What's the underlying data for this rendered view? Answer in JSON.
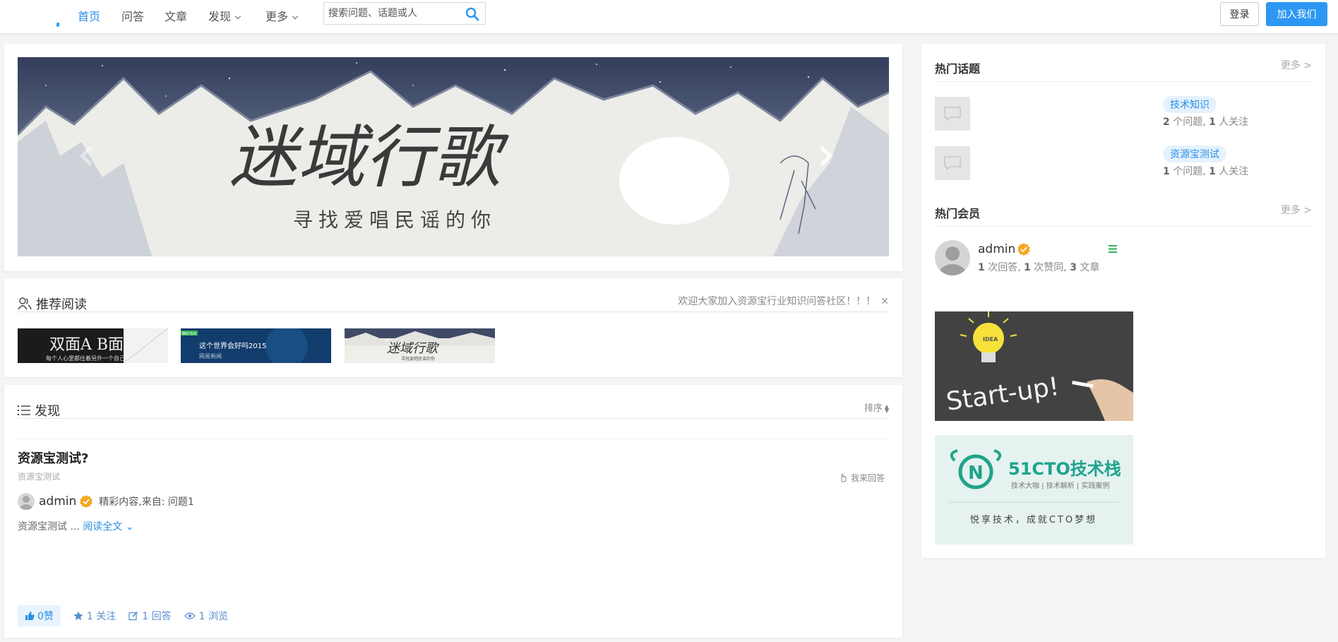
{
  "nav": {
    "items": [
      {
        "label": "首页",
        "active": true
      },
      {
        "label": "问答"
      },
      {
        "label": "文章"
      },
      {
        "label": "发现",
        "dropdown": true
      },
      {
        "label": "更多",
        "dropdown": true
      }
    ],
    "search_placeholder": "搜索问题、话题或人",
    "login_label": "登录",
    "join_label": "加入我们"
  },
  "banner": {
    "title_art": "迷域行歌",
    "subtitle": "寻找爱唱民谣的你"
  },
  "recommend": {
    "title": "推荐阅读",
    "notice": "欢迎大家加入资源宝行业知识问答社区！！！",
    "thumbs": [
      {
        "caption_main": "双面A B面",
        "caption_sub": "每个人心里都住着另外一个自己"
      },
      {
        "badge": "精彩活动",
        "caption_main": "这个世界会好吗2015",
        "caption_sub": "网易新闻"
      },
      {
        "caption_main": "迷域行歌",
        "caption_sub": "寻找爱唱民谣的你"
      }
    ]
  },
  "discover": {
    "title": "发现",
    "sort_label": "排序",
    "question": {
      "title": "资源宝测试?",
      "topic": "资源宝测试",
      "answer_link": "我来回答",
      "user": "admin",
      "source": "精彩内容,来自: 问题1",
      "excerpt": "资源宝测试 ...",
      "read_more": "阅读全文",
      "likes": "0赞",
      "follows": "1 关注",
      "answers": "1 回答",
      "views": "1 浏览"
    }
  },
  "sidebar": {
    "hot_topics": {
      "title": "热门话题",
      "more": "更多 >",
      "items": [
        {
          "tag": "技术知识",
          "questions": "2",
          "q_unit": " 个问题, ",
          "follows": "1",
          "f_unit": " 人关注"
        },
        {
          "tag": "资源宝测试",
          "questions": "1",
          "q_unit": " 个问题, ",
          "follows": "1",
          "f_unit": " 人关注"
        }
      ]
    },
    "hot_members": {
      "title": "热门会员",
      "more": "更多 >",
      "user": {
        "name": "admin",
        "answers": "1",
        "a_unit": " 次回答, ",
        "agrees": "1",
        "g_unit": " 次赞同, ",
        "articles": "3",
        "r_unit": " 文章"
      }
    },
    "ads": [
      {
        "text": "Start-up!",
        "bulb_text": "IDEA"
      },
      {
        "brand": "51CTO技术栈",
        "tagline": "技术大咖 | 技术解析 | 实践案例",
        "slogan": "悦享技术，成就CTO梦想"
      }
    ]
  },
  "colors": {
    "accent": "#2d98f3",
    "link": "#2b8ee6",
    "badge": "#f5a623",
    "menu_green": "#2fb35a",
    "teal": "#1fa38c"
  }
}
